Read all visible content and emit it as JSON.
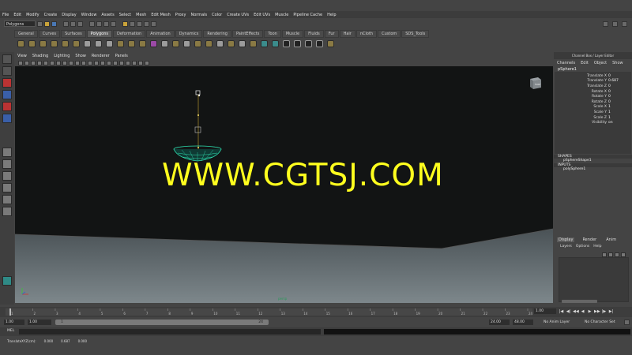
{
  "menubar": [
    "File",
    "Edit",
    "Modify",
    "Create",
    "Display",
    "Window",
    "Assets",
    "Select",
    "Mesh",
    "Edit Mesh",
    "Proxy",
    "Normals",
    "Color",
    "Create UVs",
    "Edit UVs",
    "Muscle",
    "Pipeline Cache",
    "Help"
  ],
  "status_line": {
    "mode": "Polygons"
  },
  "shelf_tabs": [
    "General",
    "Curves",
    "Surfaces",
    "Polygons",
    "Deformation",
    "Animation",
    "Dynamics",
    "Rendering",
    "PaintEffects",
    "Toon",
    "Muscle",
    "Fluids",
    "Fur",
    "Hair",
    "nCloth",
    "Custom",
    "SDS_Tools"
  ],
  "active_shelf_tab": "Polygons",
  "viewport": {
    "menu": [
      "View",
      "Shading",
      "Lighting",
      "Show",
      "Renderer",
      "Panels"
    ],
    "viewcube_label": "FRONT",
    "camera_label": "persp",
    "watermark": "WWW.CGTSJ.COM",
    "colors": {
      "background": "#121414",
      "ground": "#4a5256",
      "mesh": "#2de0b0",
      "watermark": "#ffff1e"
    }
  },
  "channel_box": {
    "title": "Channel Box / Layer Editor",
    "tabs": [
      "Channels",
      "Edit",
      "Object",
      "Show"
    ],
    "object": "pSphere1",
    "attributes": [
      {
        "name": "Translate X",
        "value": "0"
      },
      {
        "name": "Translate Y",
        "value": "0.687"
      },
      {
        "name": "Translate Z",
        "value": "0"
      },
      {
        "name": "Rotate X",
        "value": "0"
      },
      {
        "name": "Rotate Y",
        "value": "0"
      },
      {
        "name": "Rotate Z",
        "value": "0"
      },
      {
        "name": "Scale X",
        "value": "1"
      },
      {
        "name": "Scale Y",
        "value": "1"
      },
      {
        "name": "Scale Z",
        "value": "1"
      },
      {
        "name": "Visibility",
        "value": "on"
      }
    ],
    "shapes_title": "SHAPES",
    "shape_item": "pSphereShape1",
    "inputs_title": "INPUTS",
    "input_item": "polySphere1"
  },
  "layer_editor": {
    "tabs": [
      "Display",
      "Render",
      "Anim"
    ],
    "active_tab": "Display",
    "menu": [
      "Layers",
      "Options",
      "Help"
    ]
  },
  "time_slider": {
    "ticks": [
      "1",
      "2",
      "3",
      "4",
      "5",
      "6",
      "7",
      "8",
      "9",
      "10",
      "11",
      "12",
      "13",
      "14",
      "15",
      "16",
      "17",
      "18",
      "19",
      "20",
      "21",
      "22",
      "23",
      "24"
    ],
    "current_frame": "1.00",
    "playback_buttons": [
      "|◀",
      "◀|",
      "◀◀",
      "◀",
      "▶",
      "▶▶",
      "|▶",
      "▶|"
    ]
  },
  "range_slider": {
    "start": "1.00",
    "playback_start": "1.00",
    "range_start_marker": "1",
    "range_end_marker": "24",
    "playback_end": "24.00",
    "end": "48.00",
    "anim_layer": "No Anim Layer",
    "character_set": "No Character Set"
  },
  "command_line": {
    "language": "MEL"
  },
  "help_line": {
    "label": "TranslateXYZ(cm):",
    "x": "0.000",
    "y": "0.687",
    "z": "0.000"
  }
}
